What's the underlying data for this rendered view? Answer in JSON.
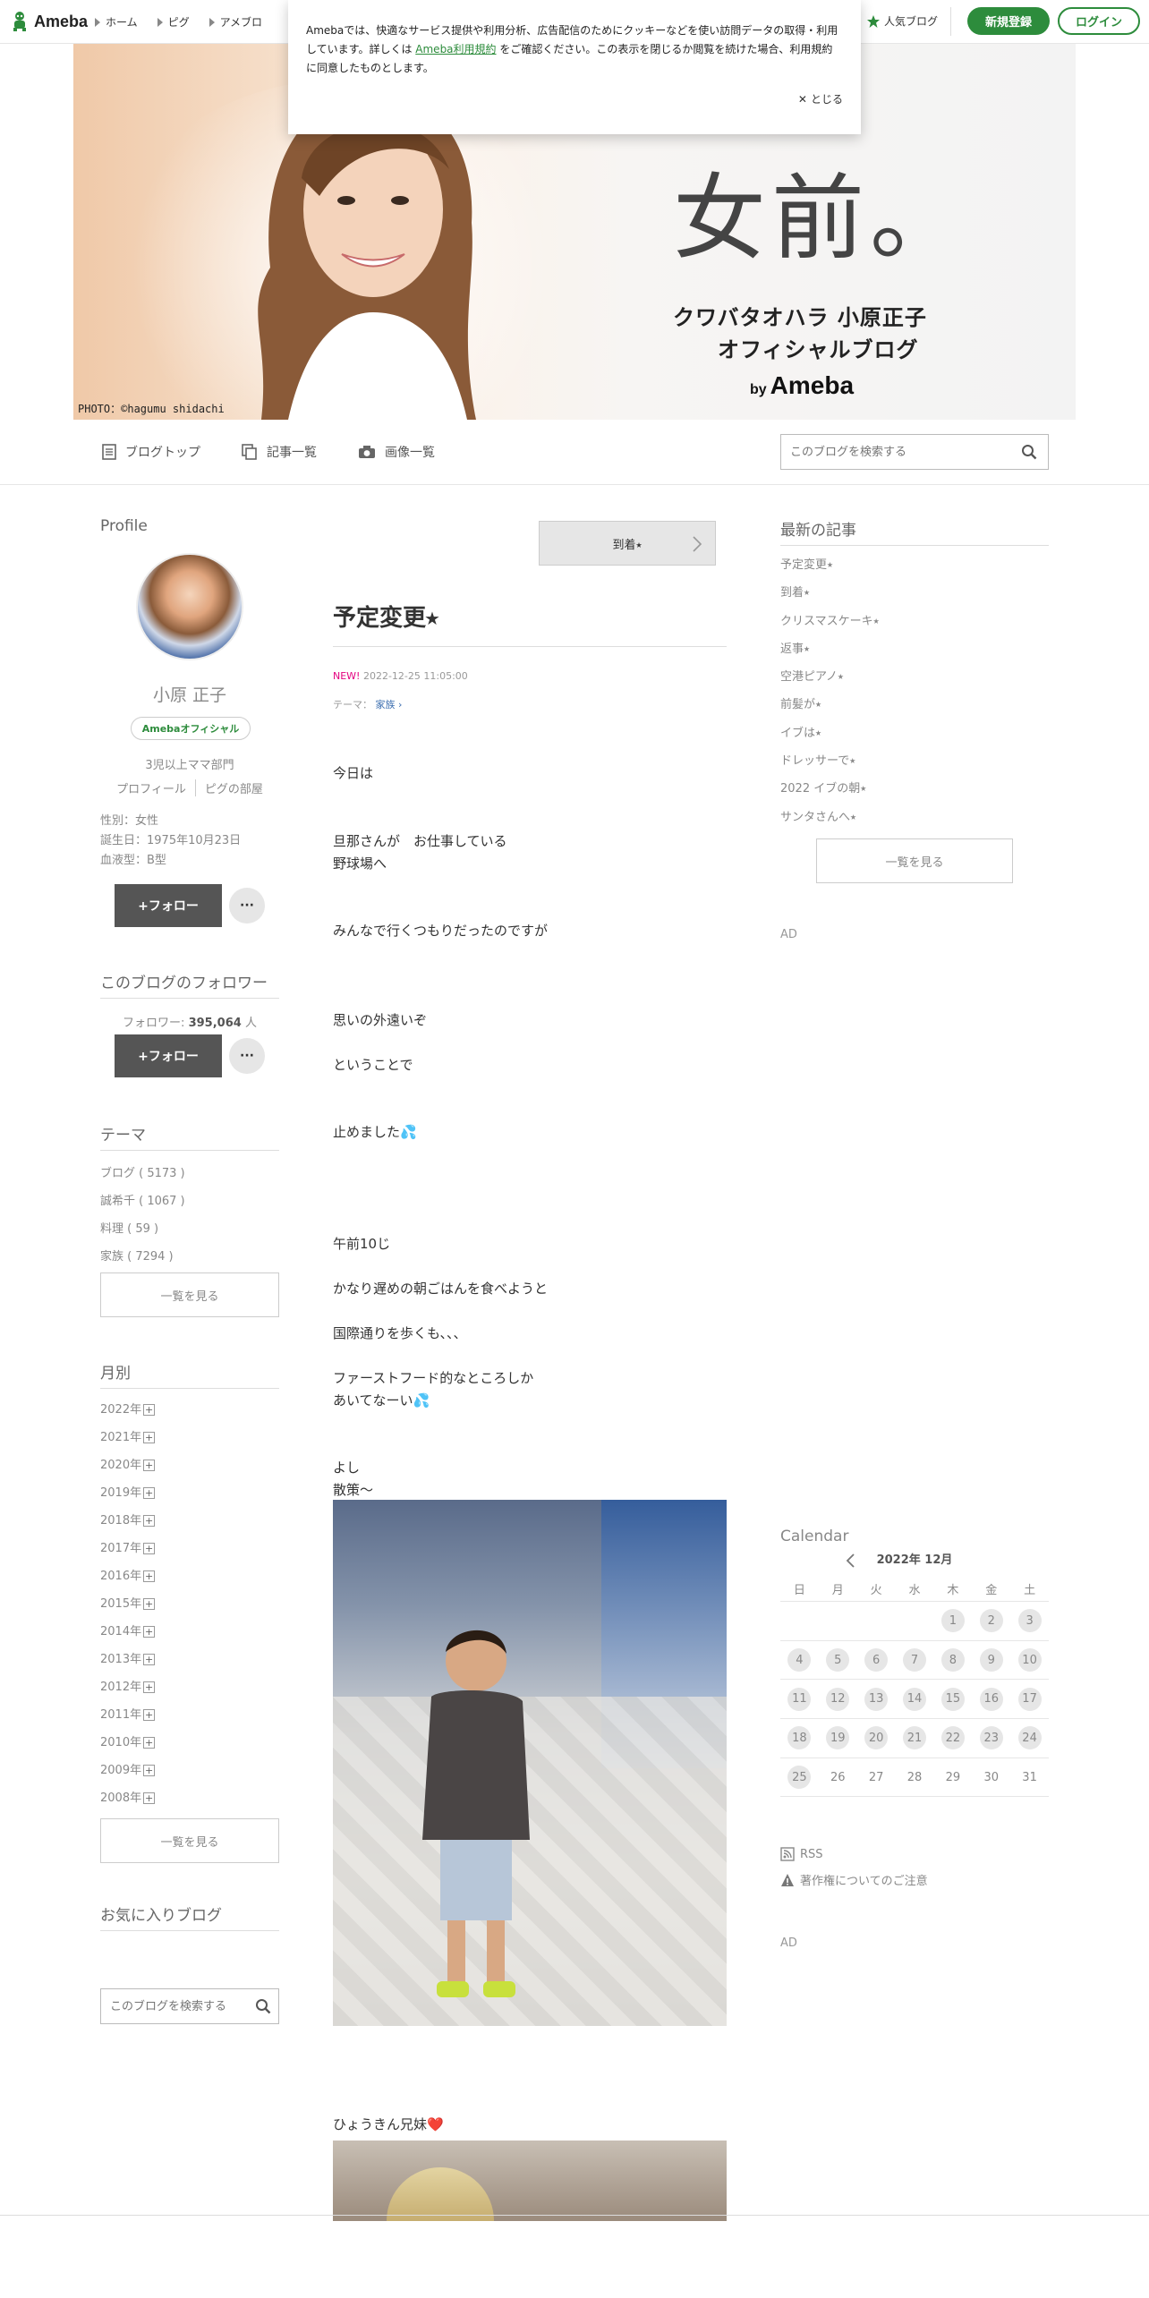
{
  "header": {
    "logo": "Ameba",
    "nav": [
      "ホーム",
      "ピグ",
      "アメブロ"
    ],
    "popular": "人気ブログ",
    "register": "新規登録",
    "login": "ログイン"
  },
  "cookie": {
    "text_before": "Amebaでは、快適なサービス提供や利用分析、広告配信のためにクッキーなどを使い訪問データの取得・利用しています。詳しくは",
    "link": "Ameba利用規約",
    "text_after": "をご確認ください。この表示を閉じるか閲覧を続けた場合、利用規約に同意したものとします。",
    "close": "とじる"
  },
  "banner": {
    "title": "女前。",
    "sub1": "クワバタオハラ 小原正子",
    "sub2": "オフィシャルブログ",
    "by": "by",
    "brand": "Ameba",
    "credit": "PHOTO：©hagumu shidachi"
  },
  "blognav": {
    "items": [
      "ブログトップ",
      "記事一覧",
      "画像一覧"
    ],
    "search_placeholder": "このブログを検索する"
  },
  "profile": {
    "title": "Profile",
    "name": "小原 正子",
    "badge": "Amebaオフィシャル",
    "category": "3児以上ママ部門",
    "link_profile": "プロフィール",
    "link_pig": "ピグの部屋",
    "gender": "性別：女性",
    "birthday": "誕生日：1975年10月23日",
    "blood": "血液型：B型",
    "follow": "+フォロー",
    "more": "···"
  },
  "followers": {
    "title": "このブログのフォロワー",
    "label": "フォロワー:",
    "count": "395,064",
    "unit": "人"
  },
  "themes": {
    "title": "テーマ",
    "items": [
      "ブログ ( 5173 )",
      "誠希千 ( 1067 )",
      "料理 ( 59 )",
      "家族 ( 7294 )"
    ],
    "more": "一覧を見る"
  },
  "monthly": {
    "title": "月別",
    "items": [
      "2022年",
      "2021年",
      "2020年",
      "2019年",
      "2018年",
      "2017年",
      "2016年",
      "2015年",
      "2014年",
      "2013年",
      "2012年",
      "2011年",
      "2010年",
      "2009年",
      "2008年"
    ],
    "plus": "+",
    "more": "一覧を見る"
  },
  "favorites": {
    "title": "お気に入りブログ",
    "search_placeholder": "このブログを検索する"
  },
  "article": {
    "next": "到着⭑",
    "title": "予定変更⭑",
    "new": "NEW!",
    "date": "2022-12-25 11:05:00",
    "theme_label": "テーマ：",
    "theme": "家族",
    "p1": "今日は",
    "p2": "旦那さんが　お仕事している\n野球場へ",
    "p3": "みんなで行くつもりだったのですが",
    "p4": "思いの外遠いぞ",
    "p5": "ということで",
    "p6": "止めました💦",
    "p7": "午前10じ",
    "p8": "かなり遅めの朝ごはんを食べようと",
    "p9": "国際通りを歩くも、、、",
    "p10": "ファーストフード的なところしか\nあいてなーい💦",
    "p11": "よし\n散策～",
    "p12": "ひょうきん兄妹❤️"
  },
  "recent": {
    "title": "最新の記事",
    "items": [
      "予定変更⭑",
      "到着⭑",
      "クリスマスケーキ⭑",
      "返事⭑",
      "空港ピアノ⭑",
      "前髪が⭑",
      "イブは⭑",
      "ドレッサーで⭑",
      "2022 イブの朝⭑",
      "サンタさんへ⭑"
    ],
    "more": "一覧を見る",
    "ad": "AD"
  },
  "calendar": {
    "title": "Calendar",
    "month": "2022年 12月",
    "dow": [
      "日",
      "月",
      "火",
      "水",
      "木",
      "金",
      "土"
    ],
    "weeks": [
      [
        "",
        "",
        "",
        "",
        "1",
        "2",
        "3"
      ],
      [
        "4",
        "5",
        "6",
        "7",
        "8",
        "9",
        "10"
      ],
      [
        "11",
        "12",
        "13",
        "14",
        "15",
        "16",
        "17"
      ],
      [
        "18",
        "19",
        "20",
        "21",
        "22",
        "23",
        "24"
      ],
      [
        "25",
        "26",
        "27",
        "28",
        "29",
        "30",
        "31"
      ]
    ],
    "last_post_day": 25
  },
  "footer_links": {
    "rss": "RSS",
    "caution": "著作権についてのご注意",
    "ad": "AD"
  }
}
